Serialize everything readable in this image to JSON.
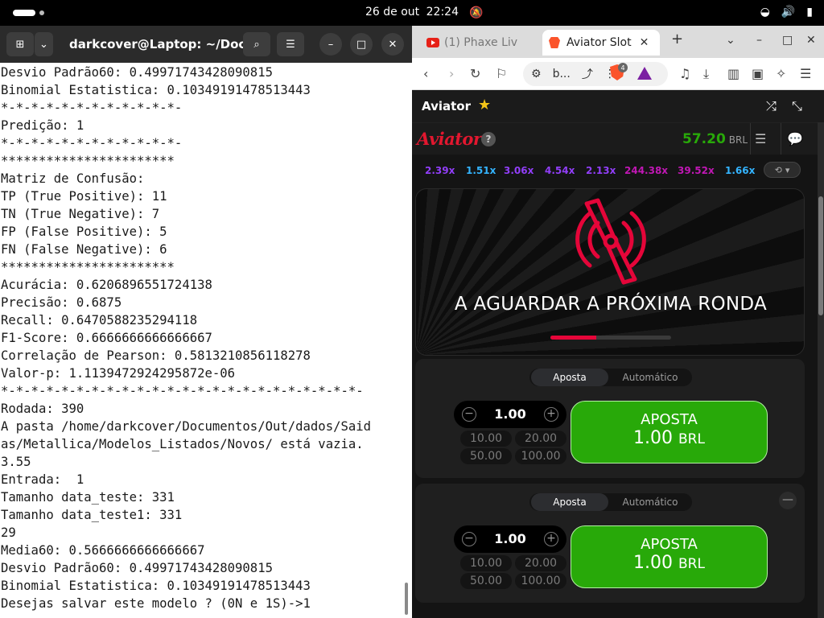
{
  "system": {
    "date": "26 de out",
    "time": "22:24"
  },
  "terminal": {
    "title": "darkcover@Laptop: ~/Doc...",
    "lines": [
      "Desvio Padrão60: 0.49971743428090815",
      "Binomial Estatistica: 0.10349191478513443",
      "*-*-*-*-*-*-*-*-*-*-*-*-",
      "Predição: 1",
      "*-*-*-*-*-*-*-*-*-*-*-*-",
      "***********************",
      "Matriz de Confusão:",
      "TP (True Positive): 11",
      "TN (True Negative): 7",
      "FP (False Positive): 5",
      "FN (False Negative): 6",
      "***********************",
      "Acurácia: 0.6206896551724138",
      "Precisão: 0.6875",
      "Recall: 0.6470588235294118",
      "F1-Score: 0.6666666666666667",
      "Correlação de Pearson: 0.5813210856118278",
      "Valor-p: 1.1139472924295872e-06",
      "*-*-*-*-*-*-*-*-*-*-*-*-*-*-*-*-*-*-*-*-*-*-*-*-",
      "Rodada: 390",
      "A pasta /home/darkcover/Documentos/Out/dados/Said",
      "as/Metallica/Modelos_Listados/Novos/ está vazia.",
      "3.55",
      "Entrada:  1",
      "Tamanho data_teste: 331",
      "Tamanho data_teste1: 331",
      "29",
      "Media60: 0.5666666666666667",
      "Desvio Padrão60: 0.49971743428090815",
      "Binomial Estatistica: 0.10349191478513443",
      "Desejas salvar este modelo ? (0N e 1S)->1"
    ]
  },
  "browser": {
    "tabs": [
      {
        "label": "(1) Phaxe Liv",
        "active": false
      },
      {
        "label": "Aviator Slot",
        "active": true
      }
    ],
    "url": "b...",
    "shield_count": "4"
  },
  "game": {
    "title": "Aviator",
    "logo": "Aviator",
    "help": "?",
    "balance": "57.20",
    "currency": "BRL",
    "history": [
      {
        "value": "2.39x",
        "tone": "purple"
      },
      {
        "value": "1.51x",
        "tone": "blue"
      },
      {
        "value": "3.06x",
        "tone": "purple"
      },
      {
        "value": "4.54x",
        "tone": "purple"
      },
      {
        "value": "2.13x",
        "tone": "purple"
      },
      {
        "value": "244.38x",
        "tone": "pink"
      },
      {
        "value": "39.52x",
        "tone": "pink"
      },
      {
        "value": "1.66x",
        "tone": "blue"
      }
    ],
    "waiting_text": "A AGUARDAR A PRÓXIMA RONDA",
    "progress_fraction": 0.38,
    "panels": [
      {
        "tab_bet": "Aposta",
        "tab_auto": "Automático",
        "amount": "1.00",
        "quick": [
          "10.00",
          "20.00",
          "50.00",
          "100.00"
        ],
        "button_title": "APOSTA",
        "button_amount": "1.00",
        "button_currency": "BRL"
      },
      {
        "tab_bet": "Aposta",
        "tab_auto": "Automático",
        "amount": "1.00",
        "quick": [
          "10.00",
          "20.00",
          "50.00",
          "100.00"
        ],
        "button_title": "APOSTA",
        "button_amount": "1.00",
        "button_currency": "BRL"
      }
    ],
    "colors": {
      "accent_red": "#e50539",
      "bet_green": "#28a909",
      "mult_blue": "#34b4ff",
      "mult_purple": "#913ef8",
      "mult_pink": "#c017b4"
    }
  }
}
